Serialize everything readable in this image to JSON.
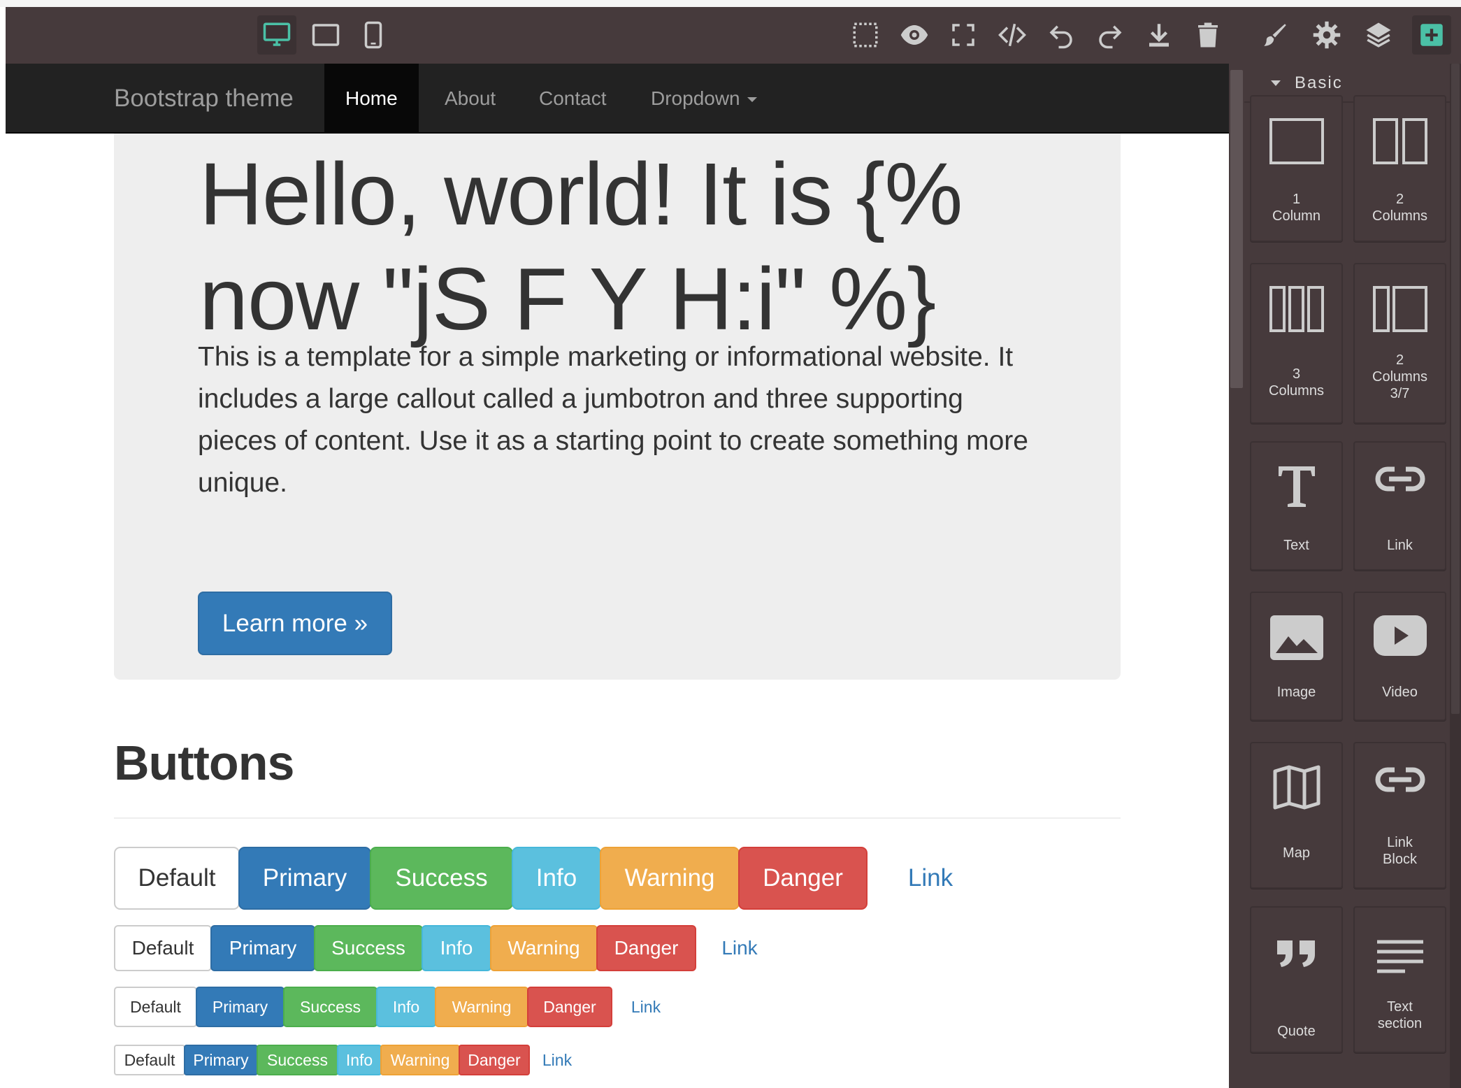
{
  "toolbar": {
    "devices": [
      "desktop-icon",
      "tablet-icon",
      "mobile-icon"
    ],
    "options": [
      "sw-visibility-icon",
      "preview-icon",
      "fullscreen-icon",
      "export-code-icon",
      "undo-icon",
      "redo-icon",
      "download-icon",
      "trash-icon"
    ],
    "views": [
      "style-manager-icon",
      "settings-icon",
      "layer-manager-icon",
      "add-block-icon"
    ],
    "accent": "#4bc0a6"
  },
  "navbar": {
    "brand": "Bootstrap theme",
    "items": [
      {
        "label": "Home"
      },
      {
        "label": "About"
      },
      {
        "label": "Contact"
      },
      {
        "label": "Dropdown"
      }
    ]
  },
  "jumbotron": {
    "title": "Hello, world! It is {% now \"jS F Y H:i\" %}",
    "text": "This is a template for a simple marketing or informational website. It includes a large callout called a jumbotron and three supporting pieces of content. Use it as a starting point to create something more unique.",
    "button": "Learn more »"
  },
  "buttons_section": {
    "heading": "Buttons",
    "labels": [
      "Default",
      "Primary",
      "Success",
      "Info",
      "Warning",
      "Danger",
      "Link"
    ]
  },
  "blocks_panel": {
    "category": "Basic",
    "blocks": [
      {
        "label": "1\nColumn",
        "icon": "one-column-icon"
      },
      {
        "label": "2\nColumns",
        "icon": "two-columns-icon"
      },
      {
        "label": "3\nColumns",
        "icon": "three-columns-icon"
      },
      {
        "label": "2\nColumns\n3/7",
        "icon": "two-columns-37-icon"
      },
      {
        "label": "Text",
        "icon": "text-icon"
      },
      {
        "label": "Link",
        "icon": "link-icon"
      },
      {
        "label": "Image",
        "icon": "image-icon"
      },
      {
        "label": "Video",
        "icon": "video-icon"
      },
      {
        "label": "Map",
        "icon": "map-icon"
      },
      {
        "label": "Link\nBlock",
        "icon": "link-block-icon"
      },
      {
        "label": "Quote",
        "icon": "quote-icon"
      },
      {
        "label": "Text\nsection",
        "icon": "text-section-icon"
      }
    ]
  }
}
